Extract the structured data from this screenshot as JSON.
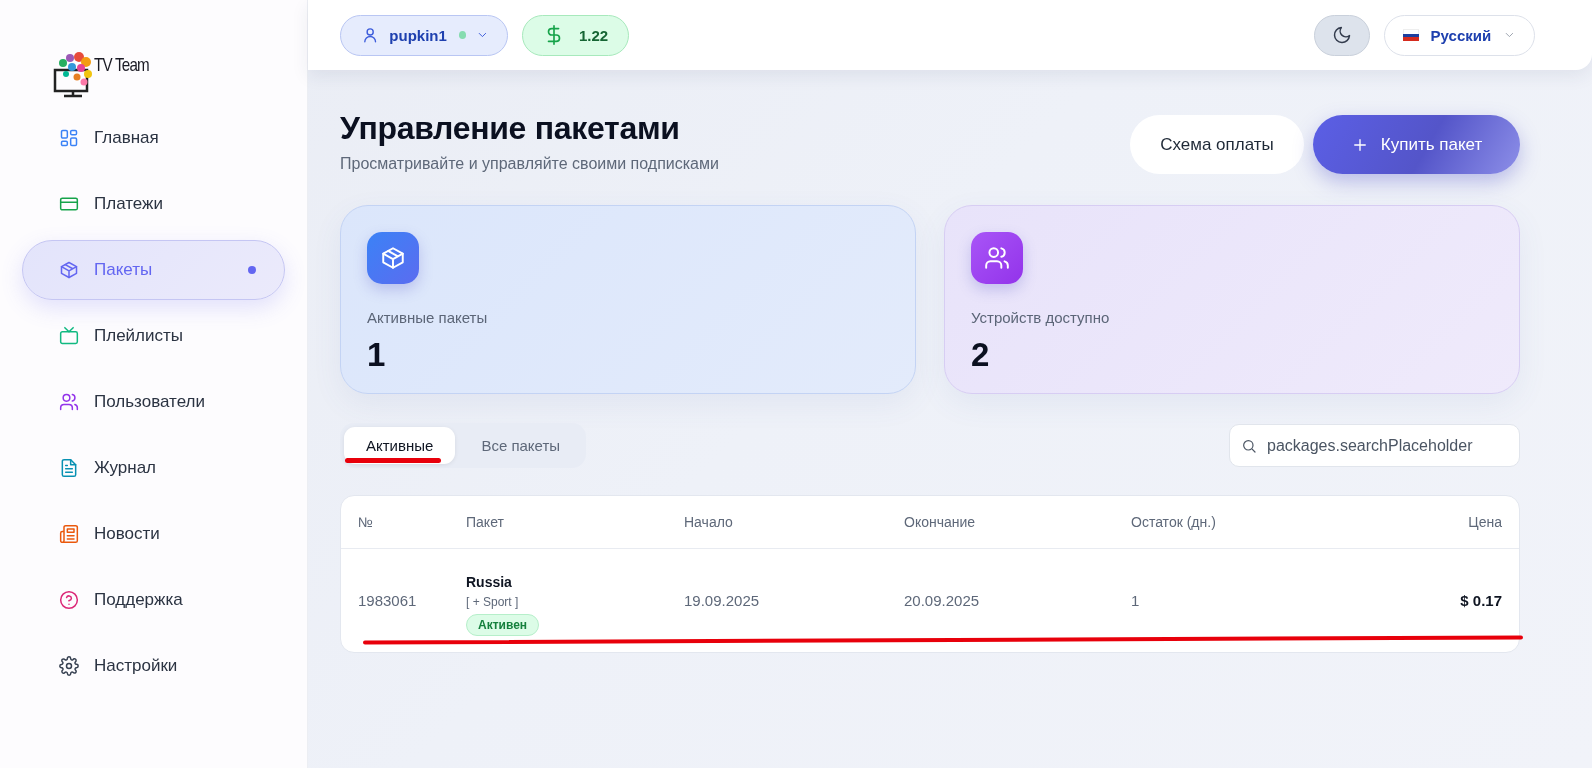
{
  "logo": {
    "text": "TV Team"
  },
  "sidebar": {
    "items": [
      {
        "label": "Главная",
        "selected": false
      },
      {
        "label": "Платежи",
        "selected": false
      },
      {
        "label": "Пакеты",
        "selected": true
      },
      {
        "label": "Плейлисты",
        "selected": false
      },
      {
        "label": "Пользователи",
        "selected": false
      },
      {
        "label": "Журнал",
        "selected": false
      },
      {
        "label": "Новости",
        "selected": false
      },
      {
        "label": "Поддержка",
        "selected": false
      },
      {
        "label": "Настройки",
        "selected": false
      }
    ]
  },
  "topbar": {
    "user": {
      "name": "pupkin1",
      "online": true
    },
    "balance": "1.22",
    "language": "Русский"
  },
  "page": {
    "title": "Управление пакетами",
    "subtitle": "Просматривайте и управляйте своими подписками",
    "buttons": [
      {
        "label": "Схема оплаты",
        "kind": "secondary"
      },
      {
        "label": "Купить пакет",
        "kind": "primary"
      }
    ]
  },
  "stats": [
    {
      "label": "Активные пакеты",
      "value": "1",
      "kind": "packages"
    },
    {
      "label": "Устройств доступно",
      "value": "2",
      "kind": "devices"
    }
  ],
  "tabs": [
    {
      "label": "Активные",
      "selected": true
    },
    {
      "label": "Все пакеты",
      "selected": false
    }
  ],
  "search": {
    "placeholder": "packages.searchPlaceholder"
  },
  "table": {
    "columns": [
      "№",
      "Пакет",
      "Начало",
      "Окончание",
      "Остаток (дн.)",
      "Цена"
    ],
    "rows": [
      {
        "number": "1983061",
        "package": "Russia",
        "extras": "[ + Sport ]",
        "status": "Активен",
        "start": "19.09.2025",
        "end": "20.09.2025",
        "days_left": "1",
        "price": "$ 0.17"
      }
    ]
  },
  "annotations": {
    "tab_underline": {
      "color": "#e8000b"
    },
    "row_underline": {
      "color": "#e8000b"
    }
  }
}
